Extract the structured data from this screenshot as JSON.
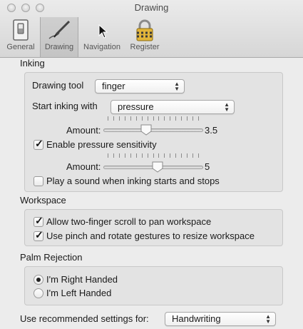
{
  "window": {
    "title": "Drawing"
  },
  "toolbar": {
    "general": "General",
    "drawing": "Drawing",
    "navigation": "Navigation",
    "register": "Register"
  },
  "inking": {
    "section_title": "Inking",
    "drawing_tool_label": "Drawing tool",
    "drawing_tool_value": "finger",
    "start_inking_label": "Start inking with",
    "start_inking_value": "pressure",
    "amount1_label": "Amount:",
    "amount1_value": "3.5",
    "amount1_level": 0.42,
    "enable_pressure_label": "Enable pressure sensitivity",
    "enable_pressure_checked": true,
    "amount2_label": "Amount:",
    "amount2_value": "5",
    "amount2_level": 0.55,
    "play_sound_label": "Play a sound when inking starts and stops",
    "play_sound_checked": false
  },
  "workspace": {
    "section_title": "Workspace",
    "two_finger_label": "Allow two-finger scroll to pan workspace",
    "two_finger_checked": true,
    "pinch_label": "Use pinch and rotate gestures to resize workspace",
    "pinch_checked": true
  },
  "palm": {
    "section_title": "Palm Rejection",
    "right_label": "I'm Right Handed",
    "left_label": "I'm Left Handed",
    "selected": "right"
  },
  "recommend": {
    "label": "Use recommended settings for:",
    "value": "Handwriting"
  }
}
